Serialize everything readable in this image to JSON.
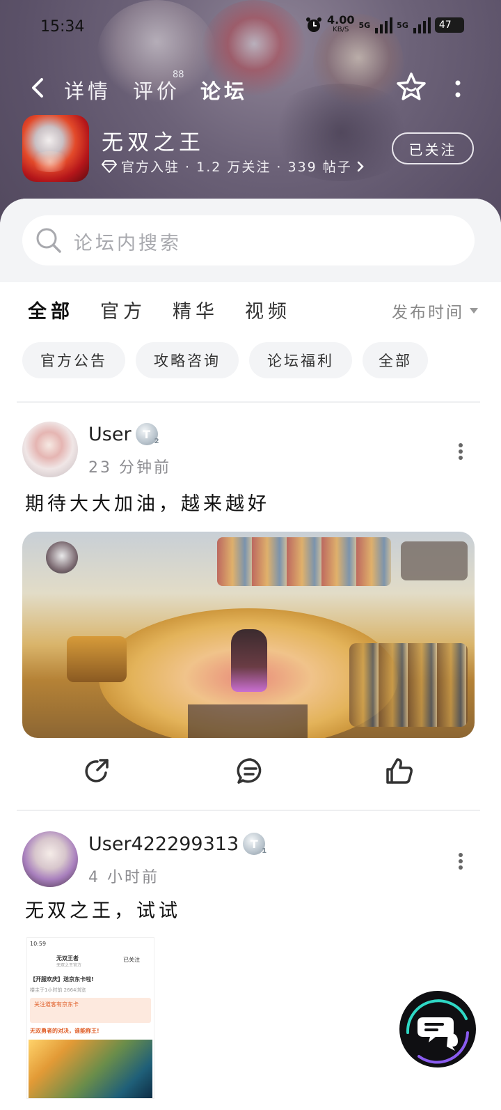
{
  "status_bar": {
    "time": "15:34",
    "speed_value": "4.00",
    "speed_unit": "KB/S",
    "network_1": "5G",
    "network_2": "5G",
    "battery": "47"
  },
  "header": {
    "tabs": [
      {
        "label": "详情"
      },
      {
        "label": "评价"
      },
      {
        "label": "论坛"
      }
    ],
    "reviews_badge": "88",
    "active_tab": "论坛"
  },
  "game": {
    "name": "无双之王",
    "meta": "官方入驻 · 1.2 万关注 · 339 帖子",
    "follow_label": "已关注"
  },
  "search": {
    "placeholder": "论坛内搜索"
  },
  "filter_tabs": [
    {
      "label": "全部"
    },
    {
      "label": "官方"
    },
    {
      "label": "精华"
    },
    {
      "label": "视频"
    }
  ],
  "sort_label": "发布时间",
  "chips": [
    {
      "label": "官方公告"
    },
    {
      "label": "攻略咨询"
    },
    {
      "label": "论坛福利"
    },
    {
      "label": "全部"
    }
  ],
  "posts": [
    {
      "user": "User",
      "level": "T",
      "level_sub": "2",
      "time": "23 分钟前",
      "text": "期待大大加油，越来越好"
    },
    {
      "user": "User422299313",
      "level": "T",
      "level_sub": "1",
      "time": "4 小时前",
      "text": "无双之王，试试",
      "thumb": {
        "time": "10:59",
        "title": "无双王者",
        "subtitle": "无双之王官方",
        "follow": "已关注",
        "headline": "【开服欢庆】送京东卡啦!",
        "meta": "楼主于1小时前  2664浏览",
        "promo": "关注道客有京东卡",
        "slogan": "无双勇者的对决，谁能称王!"
      }
    }
  ],
  "colors": {
    "accent": "#2fd8c5",
    "chip_bg": "#f3f4f6",
    "muted": "#8c8c90"
  }
}
